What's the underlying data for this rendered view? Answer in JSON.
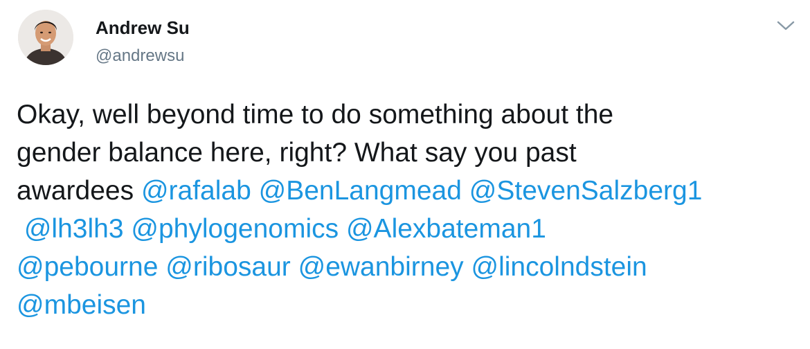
{
  "author": {
    "display_name": "Andrew Su",
    "handle": "@andrewsu"
  },
  "tweet": {
    "line1": "Okay, well beyond time to do something about the",
    "line2": "gender balance here, right?  What say you past",
    "line3_text": "awardees ",
    "mentions": [
      "@rafalab",
      "@BenLangmead",
      "@StevenSalzberg1",
      "@lh3lh3",
      "@phylogenomics",
      "@Alexbateman1",
      "@pebourne",
      "@ribosaur",
      "@ewanbirney",
      "@lincolndstein",
      "@mbeisen"
    ]
  },
  "icons": {
    "menu": "chevron-down-icon"
  },
  "colors": {
    "text": "#14171a",
    "secondary": "#657786",
    "link": "#1b95e0"
  }
}
